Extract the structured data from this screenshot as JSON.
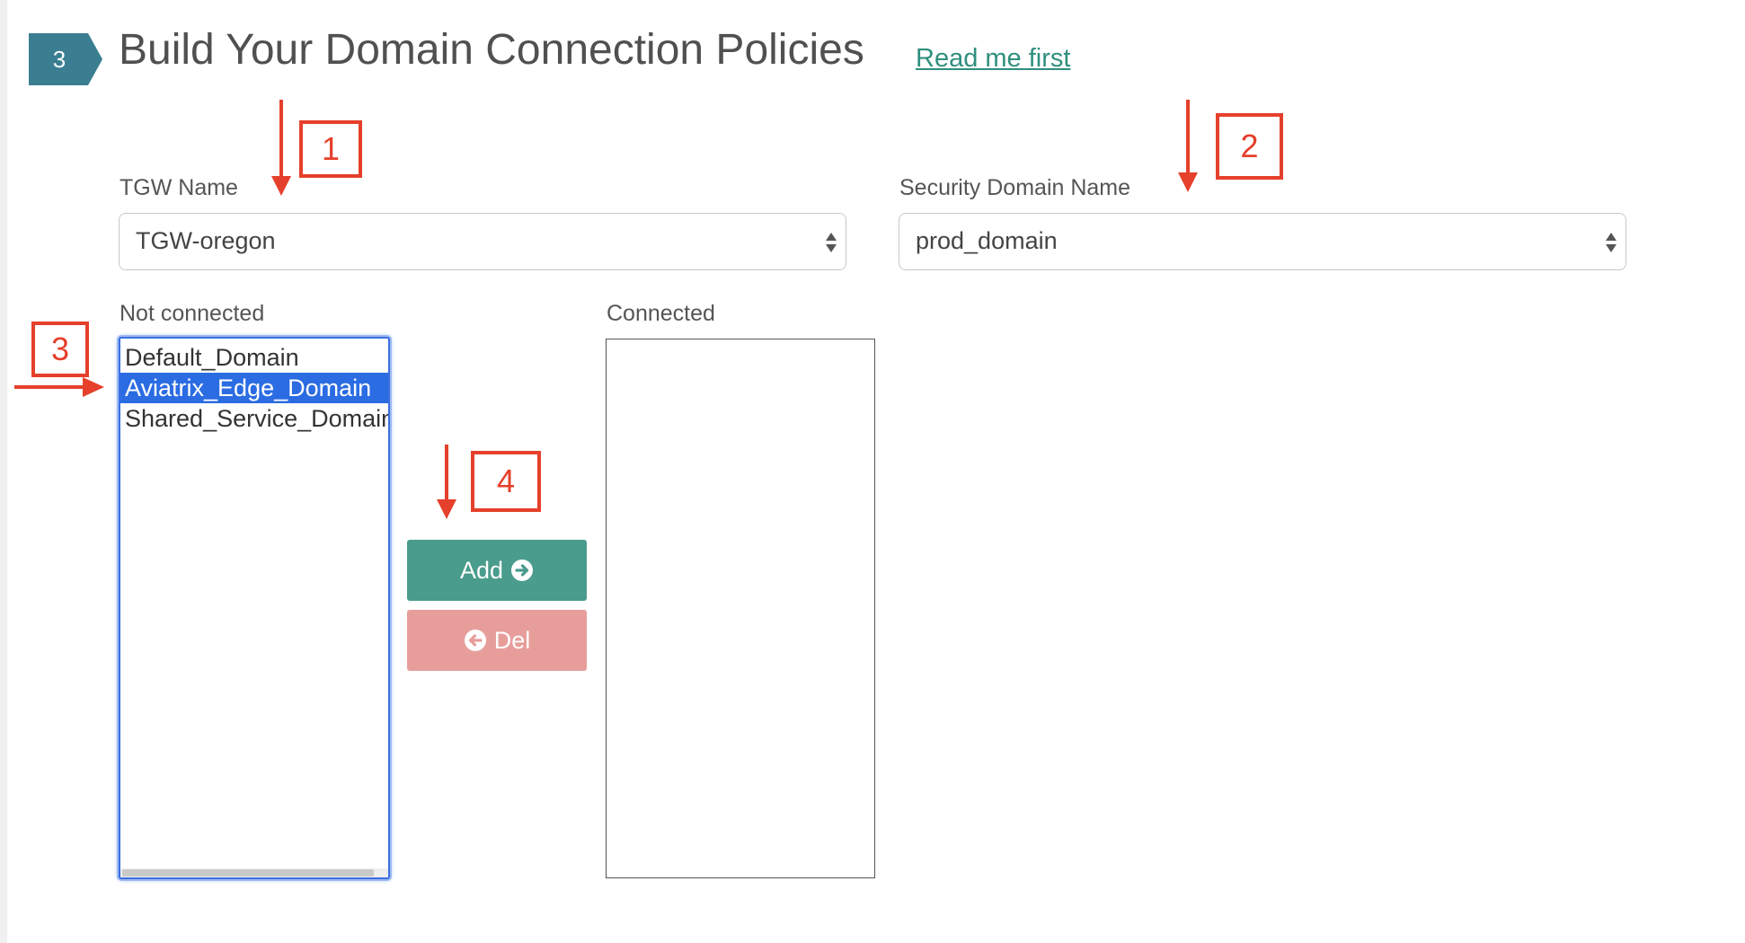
{
  "step": {
    "number": "3"
  },
  "header": {
    "title": "Build Your Domain Connection Policies",
    "read_me_link": "Read me first"
  },
  "tgw": {
    "label": "TGW Name",
    "selected": "TGW-oregon"
  },
  "security_domain": {
    "label": "Security Domain Name",
    "selected": "prod_domain"
  },
  "not_connected": {
    "label": "Not connected",
    "items": [
      "Default_Domain",
      "Aviatrix_Edge_Domain",
      "Shared_Service_Domain"
    ],
    "selected_index": 1
  },
  "connected": {
    "label": "Connected",
    "items": []
  },
  "actions": {
    "add_label": "Add",
    "del_label": "Del"
  },
  "annotations": [
    "1",
    "2",
    "3",
    "4"
  ],
  "colors": {
    "step_badge": "#3b7e92",
    "link": "#2f8f7e",
    "add_button": "#4a9c8c",
    "del_button": "#e79e9b",
    "selection": "#2b6ce3",
    "annotation": "#e5402b"
  }
}
